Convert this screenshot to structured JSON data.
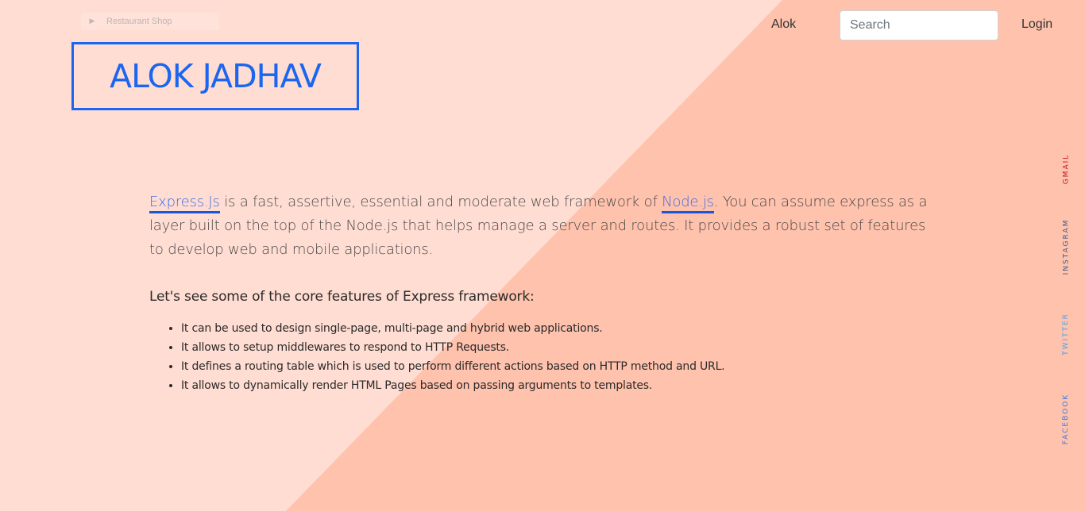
{
  "ghost_tab": {
    "label": "Restaurant Shop",
    "icon": "play-icon"
  },
  "nav": {
    "user_label": "Alok",
    "search": {
      "placeholder": "Search",
      "value": ""
    },
    "login_label": "Login"
  },
  "logo": {
    "text": "ALOK JADHAV"
  },
  "intro": {
    "link_express": "Express.Js",
    "text_1": " is a fast, assertive, essential and moderate web framework of ",
    "link_node": "Node.js",
    "text_2": ". You can assume express as a layer built on the top of the Node.js that helps manage a server and routes. It provides a robust set of features to develop web and mobile applications."
  },
  "features": {
    "heading": "Let's see some of the core features of Express framework:",
    "items": [
      "It can be used to design single-page, multi-page and hybrid web applications.",
      "It allows to setup middlewares to respond to HTTP Requests.",
      "It defines a routing table which is used to perform different actions based on HTTP method and URL.",
      "It allows to dynamically render HTML Pages based on passing arguments to templates."
    ]
  },
  "social": [
    {
      "label": "GMAIL",
      "color": "#c8102e"
    },
    {
      "label": "INSTAGRAM",
      "color": "#3f5f8f"
    },
    {
      "label": "TWITTER",
      "color": "#4da3e8"
    },
    {
      "label": "FACEBOOK",
      "color": "#3b7bdc"
    }
  ],
  "colors": {
    "background_light": "#ffddd2",
    "background_dark": "#ffc2ad",
    "accent_blue": "#1a66f0"
  }
}
